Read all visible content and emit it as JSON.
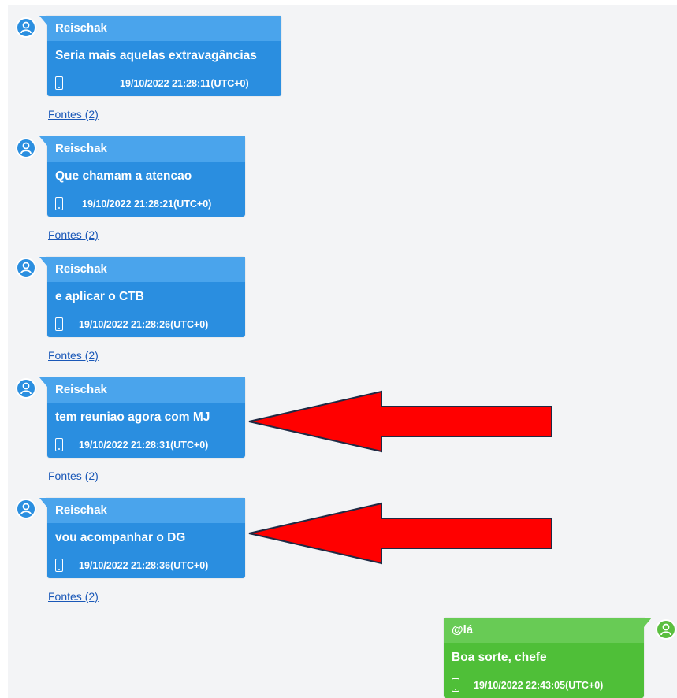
{
  "messages": [
    {
      "sender": "Reischak",
      "text": "Seria mais aquelas extravagâncias",
      "timestamp": "19/10/2022 21:28:11(UTC+0)",
      "sources": "Fontes (2)"
    },
    {
      "sender": "Reischak",
      "text": "Que chamam a atencao",
      "timestamp": "19/10/2022 21:28:21(UTC+0)",
      "sources": "Fontes (2)"
    },
    {
      "sender": "Reischak",
      "text": "e aplicar o CTB",
      "timestamp": "19/10/2022 21:28:26(UTC+0)",
      "sources": "Fontes (2)"
    },
    {
      "sender": "Reischak",
      "text": "tem reuniao agora com MJ",
      "timestamp": "19/10/2022 21:28:31(UTC+0)",
      "sources": "Fontes (2)"
    },
    {
      "sender": "Reischak",
      "text": "vou acompanhar o DG",
      "timestamp": "19/10/2022 21:28:36(UTC+0)",
      "sources": "Fontes (2)"
    }
  ],
  "reply": {
    "sender": "@lá",
    "text": "Boa sorte, chefe",
    "timestamp": "19/10/2022 22:43:05(UTC+0)"
  },
  "annotations": {
    "arrow_color": "#ff0000",
    "arrow_outline": "#1f2a44"
  },
  "colors": {
    "incoming_bubble": "#2a8ee0",
    "incoming_header": "#4aa4ec",
    "outgoing_bubble": "#4fbf38",
    "outgoing_header": "#68cb55",
    "link": "#1a58b8"
  }
}
